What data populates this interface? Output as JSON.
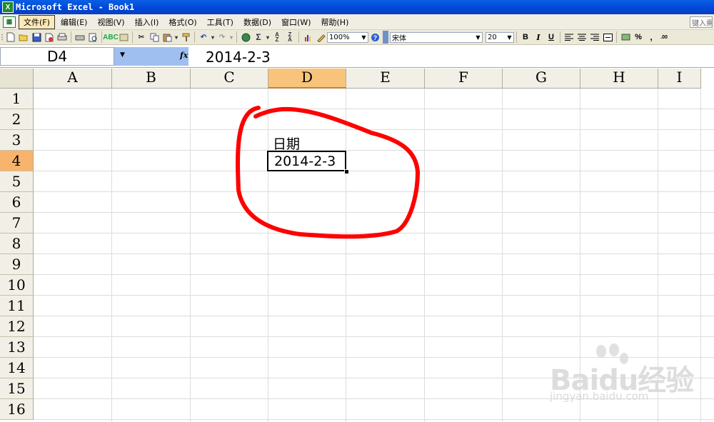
{
  "window": {
    "title": "Microsoft Excel - Book1"
  },
  "menu": {
    "items": [
      "文件(F)",
      "编辑(E)",
      "视图(V)",
      "插入(I)",
      "格式(O)",
      "工具(T)",
      "数据(D)",
      "窗口(W)",
      "帮助(H)"
    ],
    "active": "文件(F)",
    "help_placeholder": "键入需"
  },
  "toolbar": {
    "zoom": "100%",
    "font_name": "宋体",
    "font_size": "20",
    "percent": "%",
    "comma": ","
  },
  "formula_bar": {
    "name_box": "D4",
    "fx": "fx",
    "value": "2014-2-3"
  },
  "sheet": {
    "columns": [
      "A",
      "B",
      "C",
      "D",
      "E",
      "F",
      "G",
      "H",
      "I"
    ],
    "selected_column": "D",
    "rows": [
      "1",
      "2",
      "3",
      "4",
      "5",
      "6",
      "7",
      "8",
      "9",
      "10",
      "11",
      "12",
      "13",
      "14",
      "15",
      "16"
    ],
    "selected_row": "4",
    "cells": {
      "D3": "日期",
      "D4": "2014-2-3"
    },
    "active_cell": "D4"
  },
  "annotation": {
    "shape": "red-freehand-circle",
    "color": "#ff0000"
  },
  "watermark": {
    "logo": "Baidu经验",
    "url": "jingyan.baidu.com"
  }
}
